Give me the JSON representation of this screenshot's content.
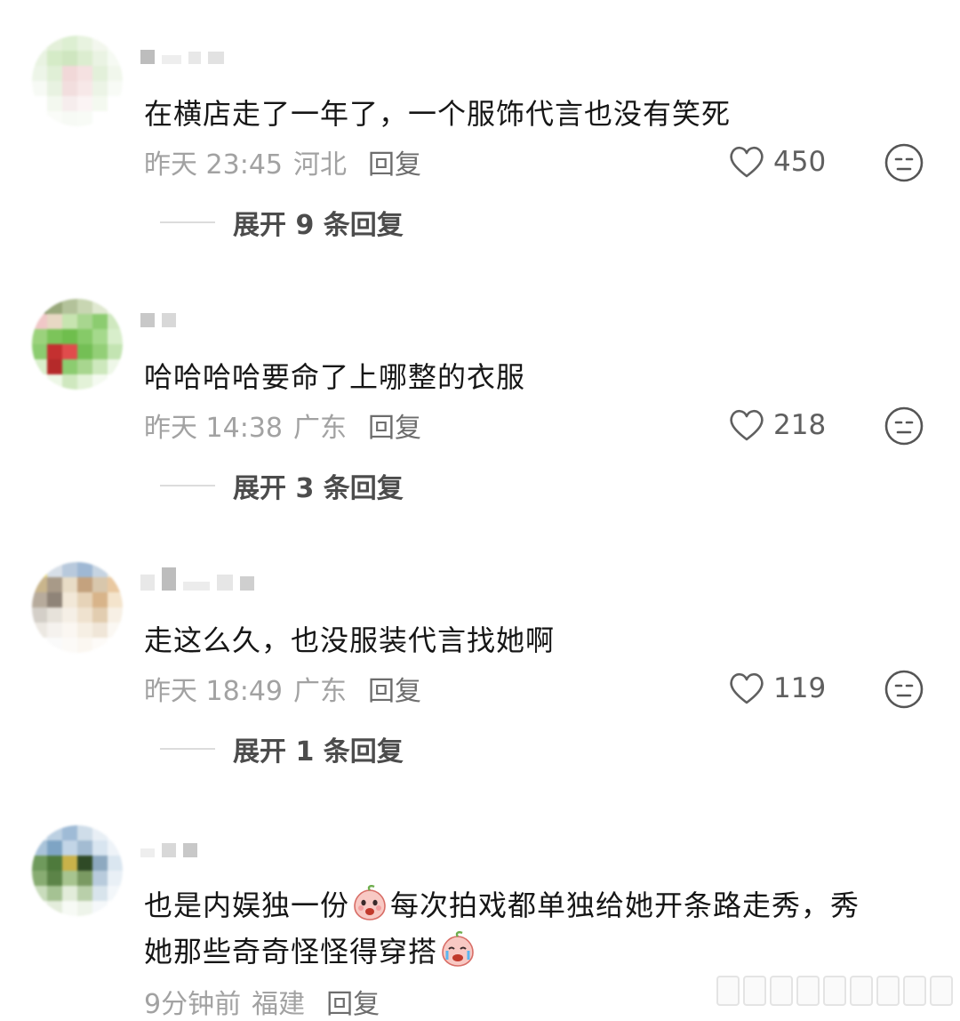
{
  "colors": {
    "accent_text": "#161616",
    "meta_text": "#a2a2a2",
    "reply_text": "#6d6d6d"
  },
  "comments": [
    {
      "text": "在横店走了一年了，一个服饰代言也没有笑死",
      "time": "昨天 23:45",
      "location": "河北",
      "reply_label": "回复",
      "likes": "450",
      "expand_label": "展开 9 条回复",
      "avatar_colors": [
        "#f1f6ec",
        "#e4f0da",
        "#ddefd2",
        "#e8f3e0",
        "#f3f7ee",
        "#fafcf8",
        "#e9f3e2",
        "#d5ebc7",
        "#cfe6c0",
        "#dcedd0",
        "#eaf3e3",
        "#f6faf3",
        "#edf5e8",
        "#e0efd6",
        "#f1d8d8",
        "#f5e1e1",
        "#e3f0da",
        "#f1f7ec",
        "#f7faf5",
        "#e8f2e1",
        "#f2dede",
        "#f7e8e8",
        "#ecf4e6",
        "#f8fbf6",
        "#ffffff",
        "#f3f8ef",
        "#f6eded",
        "#fbf4f4",
        "#f4f9f0",
        "#ffffff",
        "#ffffff",
        "#fafcf8",
        "#f7faf5",
        "#f8fbf6",
        "#ffffff",
        "#ffffff"
      ]
    },
    {
      "text": "哈哈哈哈要命了上哪整的衣服",
      "time": "昨天 14:38",
      "location": "广东",
      "reply_label": "回复",
      "likes": "218",
      "expand_label": "展开 3 条回复",
      "avatar_colors": [
        "#7e8f62",
        "#98a87b",
        "#b3c29a",
        "#c8d6b2",
        "#dfe8d0",
        "#f1f5ea",
        "#f0c7c7",
        "#e8d8c4",
        "#c7e4b0",
        "#a8d68f",
        "#8ccc70",
        "#cfe8bf",
        "#9bd27c",
        "#7cc45a",
        "#6fbe4d",
        "#86ca68",
        "#a5d98c",
        "#d8eecb",
        "#8ccc70",
        "#c43030",
        "#e04c4c",
        "#74bf55",
        "#93cf77",
        "#c3e4b2",
        "#d9efcc",
        "#b52a2a",
        "#8ccc70",
        "#a8d68f",
        "#cde8bd",
        "#eef7e8",
        "#ffffff",
        "#edf7e6",
        "#cfe8bf",
        "#e3f2d8",
        "#f4faf0",
        "#ffffff"
      ]
    },
    {
      "text": "走这么久，也没服装代言找她啊",
      "time": "昨天 18:49",
      "location": "广东",
      "reply_label": "回复",
      "likes": "119",
      "expand_label": "展开 1 条回复",
      "avatar_colors": [
        "#e8d77a",
        "#d7dfe8",
        "#b8c9dc",
        "#9fb8d4",
        "#c6d4e2",
        "#f0eee0",
        "#c9b58c",
        "#a89a88",
        "#e8dcc6",
        "#c4a27e",
        "#d8c7ac",
        "#e9c8a0",
        "#b7ab9c",
        "#8f8478",
        "#f2e8d8",
        "#e6d3b8",
        "#d8b48a",
        "#f4e4cc",
        "#d4cfc8",
        "#e7e2da",
        "#f5efe6",
        "#efe2cf",
        "#e2cdb0",
        "#f7f0e5",
        "#ece8e2",
        "#f5f2ee",
        "#fbf7f2",
        "#f6efe4",
        "#f0e6d8",
        "#fbf8f3",
        "#ffffff",
        "#fafafa",
        "#fcfaf7",
        "#fbf7f1",
        "#fdfbf8",
        "#ffffff"
      ]
    },
    {
      "text_line1_a": "也是内娱独一份",
      "text_line1_b": "每次拍戏都单独给她开条路走秀，秀",
      "text_line2": "她那些奇奇怪怪得穿搭",
      "time": "9分钟前",
      "location": "福建",
      "reply_label": "回复",
      "avatar_colors": [
        "#dfe8f0",
        "#bcd0e2",
        "#9fbbd6",
        "#cfdde9",
        "#e8eff5",
        "#f5f8fb",
        "#a9c3d9",
        "#7ea4c4",
        "#c2d5e6",
        "#a3bcd2",
        "#d8e5f0",
        "#eef3f8",
        "#6f9a5c",
        "#4e7a3c",
        "#c9b24a",
        "#2f4a26",
        "#8da9c0",
        "#dae6f0",
        "#88ac72",
        "#5c8448",
        "#a7c48f",
        "#7a9a62",
        "#b8cbdc",
        "#e9f0f6",
        "#c9dcbc",
        "#a5c293",
        "#e2ecda",
        "#b9cfaa",
        "#d8e4ec",
        "#f3f7fa",
        "#f2f6ef",
        "#e4eddc",
        "#f7faf5",
        "#eef4ea",
        "#f5f8fa",
        "#ffffff"
      ]
    }
  ],
  "icons": {
    "like": "heart-icon",
    "react": "neutral-face-icon",
    "inline_emoji": "crying-peach-emoji-icon"
  }
}
